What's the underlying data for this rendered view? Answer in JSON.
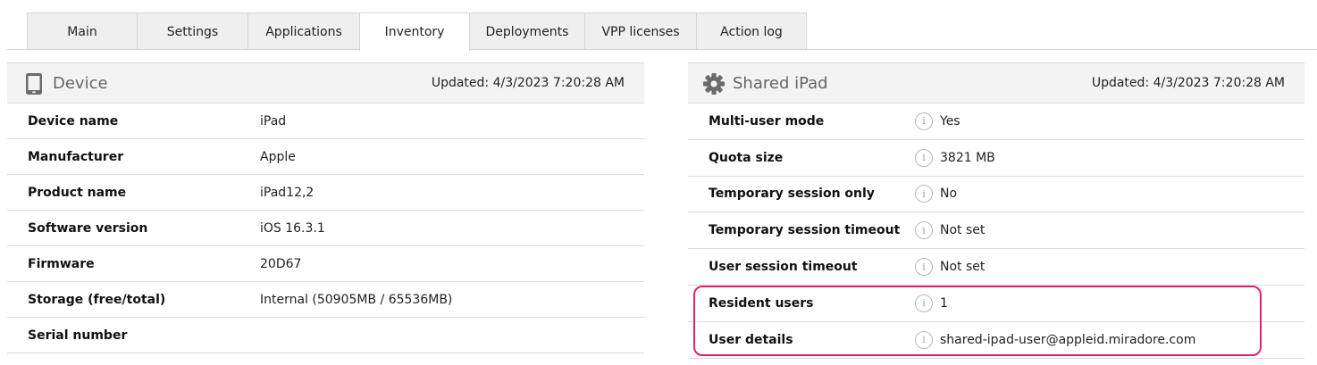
{
  "tabs": [
    {
      "label": "Main",
      "active": false
    },
    {
      "label": "Settings",
      "active": false
    },
    {
      "label": "Applications",
      "active": false
    },
    {
      "label": "Inventory",
      "active": true
    },
    {
      "label": "Deployments",
      "active": false
    },
    {
      "label": "VPP licenses",
      "active": false
    },
    {
      "label": "Action log",
      "active": false
    }
  ],
  "device": {
    "title": "Device",
    "icon": "tablet-icon",
    "updated": "Updated: 4/3/2023 7:20:28 AM",
    "rows": [
      {
        "label": "Device name",
        "value": "iPad"
      },
      {
        "label": "Manufacturer",
        "value": "Apple"
      },
      {
        "label": "Product name",
        "value": "iPad12,2"
      },
      {
        "label": "Software version",
        "value": "iOS 16.3.1"
      },
      {
        "label": "Firmware",
        "value": "20D67"
      },
      {
        "label": "Storage (free/total)",
        "value": "Internal (50905MB / 65536MB)"
      },
      {
        "label": "Serial number",
        "value": ""
      }
    ]
  },
  "shared_ipad": {
    "title": "Shared iPad",
    "icon": "gear-icon",
    "updated": "Updated: 4/3/2023 7:20:28 AM",
    "rows": [
      {
        "label": "Multi-user mode",
        "value": "Yes"
      },
      {
        "label": "Quota size",
        "value": "3821 MB"
      },
      {
        "label": "Temporary session only",
        "value": "No"
      },
      {
        "label": "Temporary session timeout",
        "value": "Not set"
      },
      {
        "label": "User session timeout",
        "value": "Not set"
      },
      {
        "label": "Resident users",
        "value": "1"
      },
      {
        "label": "User details",
        "value": "shared-ipad-user@appleid.miradore.com"
      }
    ]
  },
  "colors": {
    "highlight": "#e2206f",
    "header_bg": "#f3f3f3",
    "tab_bg": "#efefef"
  }
}
